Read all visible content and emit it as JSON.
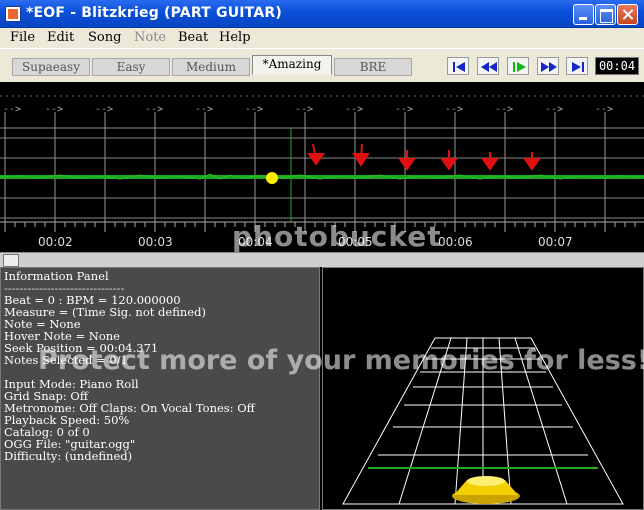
{
  "window": {
    "title": "*EOF - Blitzkrieg (PART GUITAR)"
  },
  "menu": {
    "file": "File",
    "edit": "Edit",
    "song": "Song",
    "note": "Note",
    "beat": "Beat",
    "help": "Help"
  },
  "difficulty_tabs": [
    {
      "label": "Supaeasy"
    },
    {
      "label": "Easy"
    },
    {
      "label": "Medium"
    },
    {
      "label": "*Amazing"
    },
    {
      "label": "BRE"
    }
  ],
  "active_tab": "*Amazing",
  "transport": {
    "time": "00:04",
    "buttons": [
      "seek-start-icon",
      "rewind-icon",
      "play-icon",
      "fast-forward-icon",
      "seek-end-icon"
    ]
  },
  "timeline": {
    "beat_marker": "-->",
    "time_labels": [
      "00:02",
      "00:03",
      "00:04",
      "00:05",
      "00:06",
      "00:07"
    ],
    "colors": {
      "waveform": "#1ea81e",
      "note_marker": "#e01010",
      "playhead": "#1ea81e",
      "seek_dot": "#ffee00"
    }
  },
  "info_panel": {
    "title": "Information Panel",
    "separator": "-------------------------------",
    "lines": [
      "Beat = 0 : BPM = 120.000000",
      "Measure = (Time Sig. not defined)",
      "Note = None",
      "Hover Note = None",
      "Seek Position = 00:04.371",
      "Notes Selected = 0/1",
      "Input Mode: Piano Roll",
      "Grid Snap: Off",
      "Metronome: Off  Claps: On  Vocal Tones: Off",
      "Playback Speed: 50%",
      "Catalog: 0 of 0",
      "OGG File: \"guitar.ogg\"",
      "Difficulty: (undefined)"
    ]
  },
  "watermark": {
    "logo": "photobucket",
    "tagline": "Protect more of your memories for less!"
  }
}
